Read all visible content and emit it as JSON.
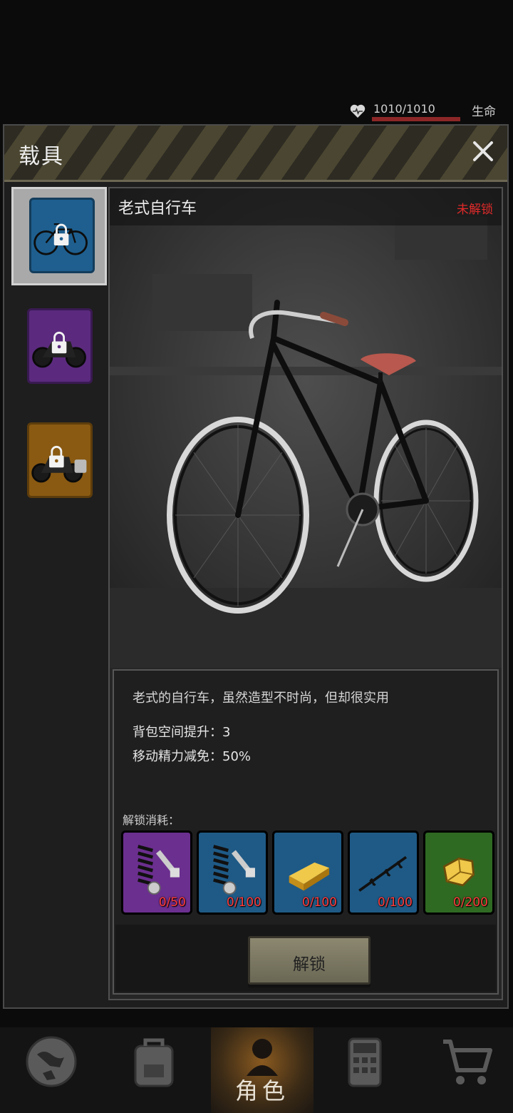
{
  "status": {
    "life_value": "1010/1010",
    "life_label": "生命"
  },
  "panel": {
    "title": "载具",
    "close_icon": "close-icon"
  },
  "tabs": [
    {
      "name": "老式自行车",
      "icon": "bicycle-lock-icon",
      "rarity_color": "#1e5f8f",
      "active": true
    },
    {
      "name": "motorcycle",
      "icon": "motorcycle-lock-icon",
      "rarity_color": "#5b2a7e",
      "active": false
    },
    {
      "name": "touring-motorcycle",
      "icon": "touring-motorcycle-lock-icon",
      "rarity_color": "#8a5a12",
      "active": false
    }
  ],
  "vehicle": {
    "name": "老式自行车",
    "status": "未解锁",
    "description": "老式的自行车，虽然造型不时尚，但却很实用",
    "stats": {
      "backpack": "背包空间提升：3",
      "stamina": "移动精力减免：50%"
    }
  },
  "cost": {
    "label": "解锁消耗：",
    "items": [
      {
        "icon": "spring-bolt-icon",
        "count": "0/50",
        "color": "#6b2f8f"
      },
      {
        "icon": "spring-bolt-icon",
        "count": "0/100",
        "color": "#1f5a86"
      },
      {
        "icon": "gold-bar-icon",
        "count": "0/100",
        "color": "#1f5a86"
      },
      {
        "icon": "barbed-wire-icon",
        "count": "0/100",
        "color": "#1f5a86"
      },
      {
        "icon": "gold-nugget-icon",
        "count": "0/200",
        "color": "#2f6a23"
      }
    ]
  },
  "unlock_button": "解锁",
  "bottom_nav": [
    {
      "icon": "globe-icon"
    },
    {
      "icon": "backpack-icon"
    },
    {
      "icon": "character-icon",
      "label": "角色"
    },
    {
      "icon": "calculator-icon"
    },
    {
      "icon": "cart-icon"
    }
  ]
}
